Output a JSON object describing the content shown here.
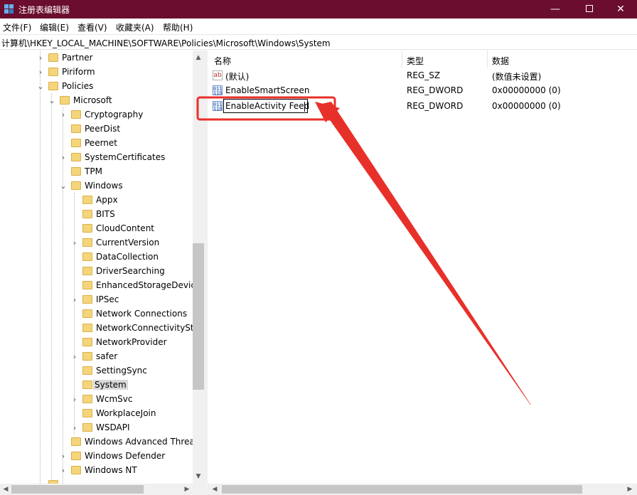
{
  "window": {
    "title": "注册表编辑器",
    "controls": {
      "minimize": "—",
      "maximize": "",
      "close": "✕"
    }
  },
  "menu": {
    "items": [
      {
        "label": "文件(F)"
      },
      {
        "label": "编辑(E)"
      },
      {
        "label": "查看(V)"
      },
      {
        "label": "收藏夹(A)"
      },
      {
        "label": "帮助(H)"
      }
    ]
  },
  "address": {
    "path": "计算机\\HKEY_LOCAL_MACHINE\\SOFTWARE\\Policies\\Microsoft\\Windows\\System"
  },
  "tree": {
    "items": [
      {
        "label": "Partner",
        "expander": "›"
      },
      {
        "label": "Piriform",
        "expander": "›"
      },
      {
        "label": "Policies",
        "expander": "⌄"
      },
      {
        "label": "Microsoft",
        "expander": "⌄"
      },
      {
        "label": "Cryptography",
        "expander": "›"
      },
      {
        "label": "PeerDist",
        "expander": ""
      },
      {
        "label": "Peernet",
        "expander": ""
      },
      {
        "label": "SystemCertificates",
        "expander": "›"
      },
      {
        "label": "TPM",
        "expander": ""
      },
      {
        "label": "Windows",
        "expander": "⌄"
      },
      {
        "label": "Appx",
        "expander": ""
      },
      {
        "label": "BITS",
        "expander": ""
      },
      {
        "label": "CloudContent",
        "expander": ""
      },
      {
        "label": "CurrentVersion",
        "expander": "›"
      },
      {
        "label": "DataCollection",
        "expander": ""
      },
      {
        "label": "DriverSearching",
        "expander": ""
      },
      {
        "label": "EnhancedStorageDevic",
        "expander": ""
      },
      {
        "label": "IPSec",
        "expander": "›"
      },
      {
        "label": "Network Connections",
        "expander": ""
      },
      {
        "label": "NetworkConnectivitySta",
        "expander": ""
      },
      {
        "label": "NetworkProvider",
        "expander": ""
      },
      {
        "label": "safer",
        "expander": "›"
      },
      {
        "label": "SettingSync",
        "expander": ""
      },
      {
        "label": "System",
        "expander": ""
      },
      {
        "label": "WcmSvc",
        "expander": "›"
      },
      {
        "label": "WorkplaceJoin",
        "expander": ""
      },
      {
        "label": "WSDAPI",
        "expander": "›"
      },
      {
        "label": "Windows Advanced Threa",
        "expander": ""
      },
      {
        "label": "Windows Defender",
        "expander": "›"
      },
      {
        "label": "Windows NT",
        "expander": "›"
      }
    ]
  },
  "list": {
    "headers": {
      "name": "名称",
      "type": "类型",
      "data": "数据"
    },
    "rows": [
      {
        "icon": "string-value-icon",
        "icon_text": "ab",
        "name": "(默认)",
        "type": "REG_SZ",
        "data": "(数值未设置)"
      },
      {
        "icon": "dword-value-icon",
        "icon_text": "011\n110",
        "name": "EnableSmartScreen",
        "type": "REG_DWORD",
        "data": "0x00000000 (0)"
      },
      {
        "icon": "dword-value-icon",
        "icon_text": "011\n110",
        "name": "EnableActivity Feed",
        "type": "REG_DWORD",
        "data": "0x00000000 (0)"
      }
    ]
  },
  "colors": {
    "titlebar": "#6b0d2e",
    "selection": "#d9d9d9",
    "annotation": "#e8302a",
    "folder": "#f5d57a"
  }
}
